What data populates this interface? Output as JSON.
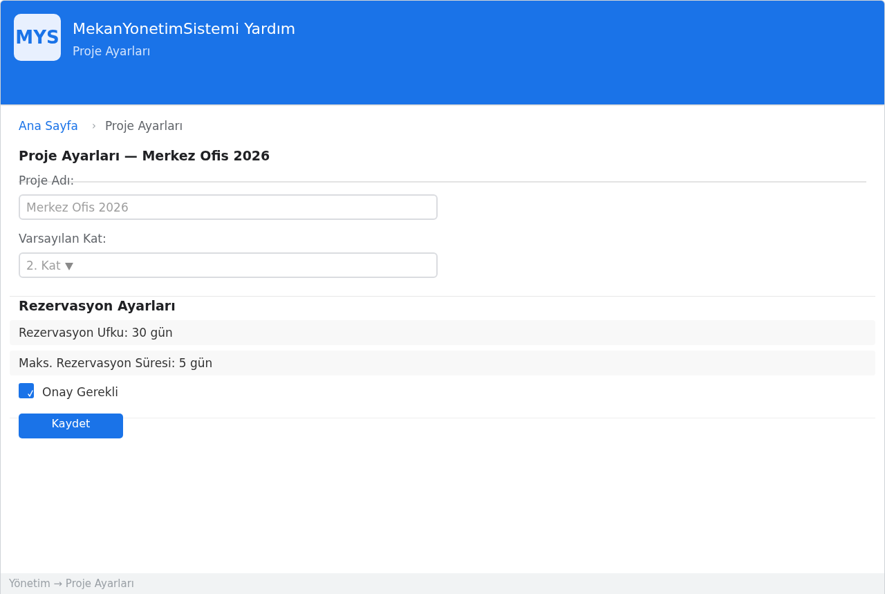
{
  "header": {
    "logo": "MYS",
    "title": "MekanYonetimSistemi Yardım",
    "subtitle": "Proje Ayarları"
  },
  "breadcrumb": {
    "items": [
      {
        "label": "Ana Sayfa",
        "kind": "link"
      },
      {
        "label": "Proje Ayarları",
        "kind": "current"
      }
    ],
    "separator": "›"
  },
  "page_title": "Proje Ayarları — Merkez Ofis 2026",
  "project_name": {
    "label": "Proje Adı:",
    "placeholder": "Merkez Ofis 2026"
  },
  "default_floor": {
    "label": "Varsayılan Kat:",
    "value": "2. Kat"
  },
  "reservation": {
    "title": "Rezervasyon Ayarları",
    "rows": [
      "Rezervasyon Ufku: 30 gün",
      "Maks. Rezervasyon Süresi: 5 gün"
    ],
    "approval": {
      "label": "Onay Gerekli",
      "checked": true
    }
  },
  "save_button": "Kaydet",
  "status_bar": "Yönetim → Proje Ayarları"
}
